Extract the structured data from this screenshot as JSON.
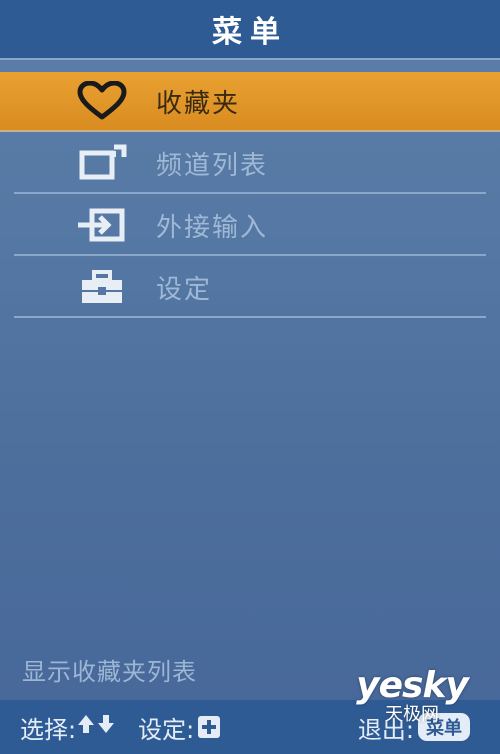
{
  "header": {
    "title": "菜单"
  },
  "menu": {
    "items": [
      {
        "label": "收藏夹",
        "icon": "heart-icon",
        "selected": true
      },
      {
        "label": "频道列表",
        "icon": "channel-list-icon",
        "selected": false
      },
      {
        "label": "外接输入",
        "icon": "input-source-icon",
        "selected": false
      },
      {
        "label": "设定",
        "icon": "toolbox-icon",
        "selected": false
      }
    ]
  },
  "info": {
    "text": "显示收藏夹列表"
  },
  "footer": {
    "select_label": "选择:",
    "select_keys": "up-down-arrow-icon",
    "set_label": "设定:",
    "set_key": "plus-key-icon",
    "exit_label": "退出:",
    "exit_key": "菜单"
  },
  "watermark": {
    "logo": "yesky",
    "sub": "天极网"
  },
  "colors": {
    "header_bg": "#2f5b95",
    "selected_bg": "#e09628",
    "item_text": "#9fb8d6",
    "background": "#5578a4"
  }
}
